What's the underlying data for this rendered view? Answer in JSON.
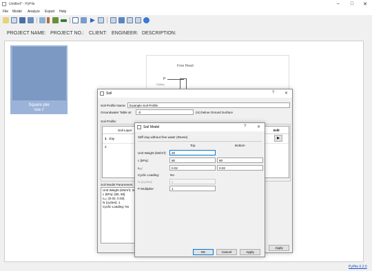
{
  "window": {
    "title": "Untitled* - PyPile"
  },
  "menu": [
    "File",
    "Model",
    "Analyze",
    "Export",
    "Help"
  ],
  "project": {
    "name_label": "PROJECT NAME:",
    "no_label": "PROJECT NO.:",
    "client_label": "CLIENT:",
    "engineer_label": "ENGINEER:",
    "description_label": "DESCRIPTION:"
  },
  "pile": {
    "name": "Square pile",
    "side": "Side 2"
  },
  "diagram": {
    "free_head": "Free Head",
    "p_label": "P",
    "pdist_label": "P(dist)"
  },
  "status": {
    "version": "PyPile 0.2.0"
  },
  "soil_dialog": {
    "title": "Soil",
    "profile_name_label": "Soil Profile Name:",
    "profile_name": "Example Soil Profile",
    "gwt_label": "Groundwater Table at:",
    "gwt_value": "-3",
    "gwt_unit": "(m) below Ground Surface",
    "profile_group_label": "Soil Profile:",
    "table_headers": {
      "soil_layer": "Soil Layer",
      "edit": "Edit"
    },
    "rows": [
      {
        "num": "1",
        "layer": "clay"
      },
      {
        "num": "2",
        "layer": ""
      }
    ],
    "params_label": "Soil Model Parameters:",
    "params_lines": [
      "Unit Weight (kN/m³): 20",
      "c (kPa): [90, 90]",
      "ε₅₀: [0.02, 0.02]",
      "N (cycles): 1",
      "Cyclic Loading: No"
    ],
    "apply_label": "Apply"
  },
  "soil_model_dialog": {
    "title": "Soil Model",
    "model_name": "Stiff clay without free water (Reese)",
    "col_top": "Top",
    "col_bottom": "Bottom",
    "unit_weight_label": "Unit Weight (kN/m³):",
    "unit_weight": "20",
    "c_label": "c (kPa):",
    "c_top": "90",
    "c_bottom": "90",
    "e50_label": "ε₅₀:",
    "e50_top": "0.02",
    "e50_bottom": "0.02",
    "cyclic_label": "Cyclic Loading:",
    "cyclic_value": "No",
    "n_label": "N (cycles):",
    "n_value": "1",
    "pmult_label": "P Multiplier:",
    "pmult_value": "1",
    "ok_label": "OK",
    "cancel_label": "Cancel",
    "apply_label": "Apply"
  }
}
